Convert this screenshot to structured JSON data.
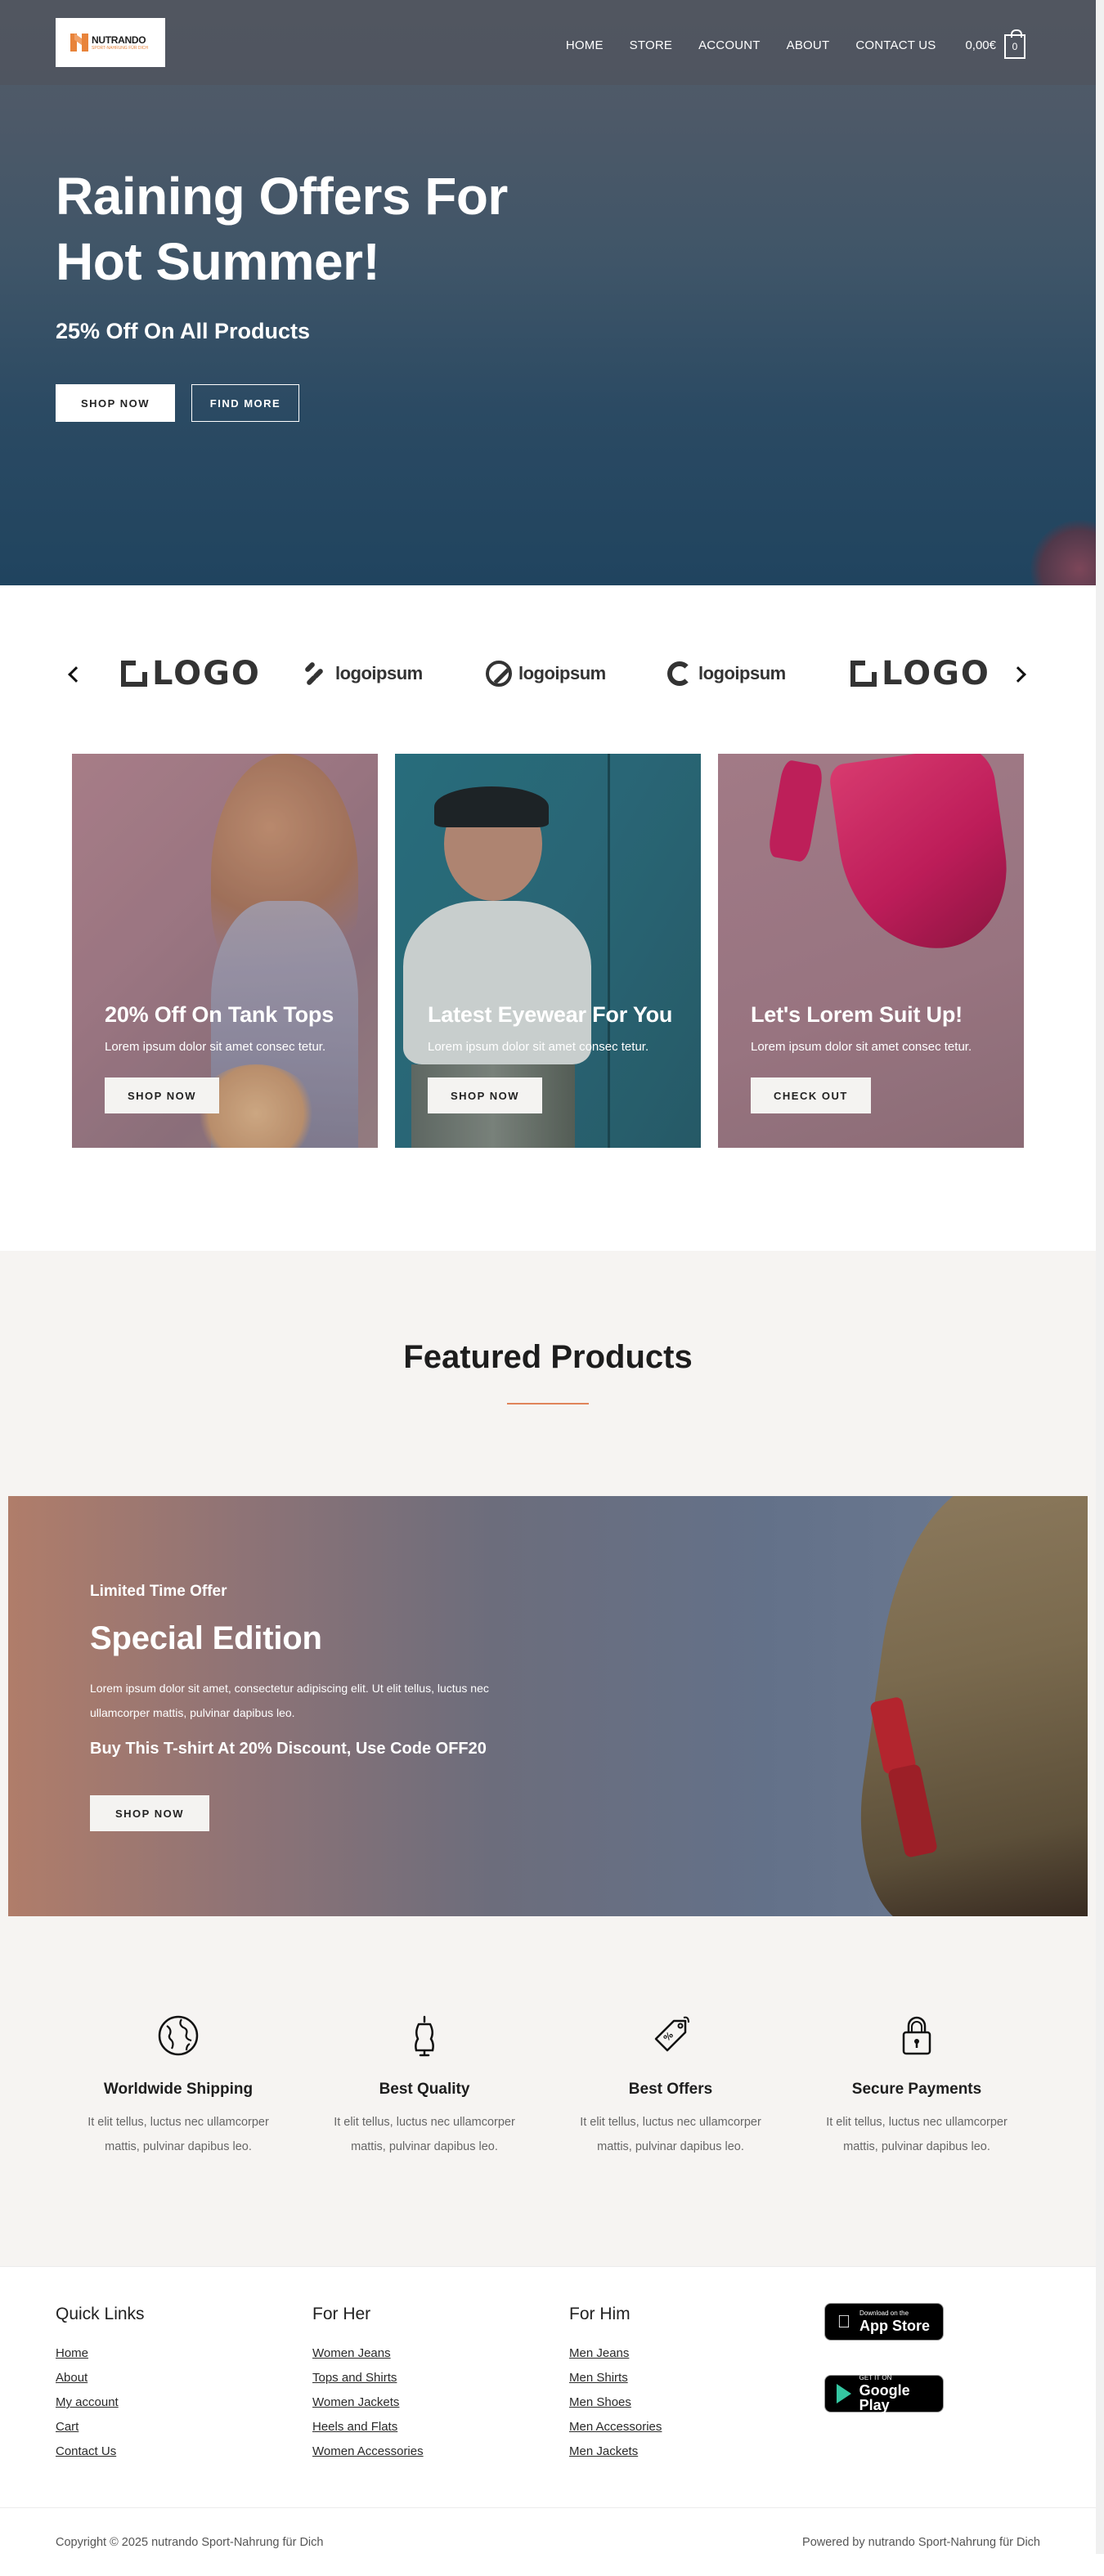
{
  "header": {
    "logo": {
      "name": "NUTRANDO",
      "tagline": "SPORT-NAHRUNG FÜR DICH"
    },
    "nav": [
      "HOME",
      "STORE",
      "ACCOUNT",
      "ABOUT",
      "CONTACT US"
    ],
    "cart": {
      "total": "0,00€",
      "count": "0"
    }
  },
  "hero": {
    "title": "Raining Offers For Hot Summer!",
    "subtitle": "25% Off On All Products",
    "primary_button": "SHOP NOW",
    "secondary_button": "FIND MORE"
  },
  "brand_strip": {
    "logos": [
      "LOGO",
      "logoipsum",
      "logoipsum",
      "logoipsum",
      "LOGO"
    ]
  },
  "promo_cards": [
    {
      "title": "20% Off On Tank Tops",
      "text": "Lorem ipsum dolor sit amet consec tetur.",
      "button": "SHOP NOW"
    },
    {
      "title": "Latest Eyewear For You",
      "text": "Lorem ipsum dolor sit amet consec tetur.",
      "button": "SHOP NOW"
    },
    {
      "title": "Let's Lorem Suit Up!",
      "text": "Lorem ipsum dolor sit amet consec tetur.",
      "button": "CHECK OUT"
    }
  ],
  "featured": {
    "title": "Featured Products"
  },
  "special": {
    "kicker": "Limited Time Offer",
    "title": "Special Edition",
    "description": "Lorem ipsum dolor sit amet, consectetur adipiscing elit. Ut elit tellus, luctus nec ullamcorper mattis, pulvinar dapibus leo.",
    "offer": "Buy This T-shirt At 20% Discount, Use Code OFF20",
    "button": "SHOP NOW"
  },
  "features": [
    {
      "icon": "globe-icon",
      "title": "Worldwide Shipping",
      "text": "It elit tellus, luctus nec ullamcorper mattis, pulvinar dapibus leo."
    },
    {
      "icon": "mannequin-icon",
      "title": "Best Quality",
      "text": "It elit tellus, luctus nec ullamcorper mattis, pulvinar dapibus leo."
    },
    {
      "icon": "price-tag-icon",
      "title": "Best Offers",
      "text": "It elit tellus, luctus nec ullamcorper mattis, pulvinar dapibus leo."
    },
    {
      "icon": "padlock-icon",
      "title": "Secure Payments",
      "text": "It elit tellus, luctus nec ullamcorper mattis, pulvinar dapibus leo."
    }
  ],
  "footer": {
    "columns": [
      {
        "title": "Quick Links",
        "links": [
          "Home",
          "About",
          "My account",
          "Cart",
          "Contact Us"
        ]
      },
      {
        "title": "For Her",
        "links": [
          "Women Jeans",
          "Tops and Shirts",
          "Women Jackets",
          "Heels and Flats",
          "Women Accessories"
        ]
      },
      {
        "title": "For Him",
        "links": [
          "Men Jeans",
          "Men Shirts",
          "Men Shoes",
          "Men Accessories",
          "Men Jackets"
        ]
      }
    ],
    "app_store": {
      "small": "Download on the",
      "big": "App Store"
    },
    "google_play": {
      "small": "GET IT ON",
      "big": "Google Play"
    },
    "copyright": "Copyright © 2025 nutrando Sport-Nahrung für Dich",
    "powered_by": "Powered by nutrando Sport-Nahrung für Dich"
  },
  "colors": {
    "accent": "#e0845a",
    "logo_orange": "#e8833a",
    "section_bg": "#f6f4f2"
  }
}
